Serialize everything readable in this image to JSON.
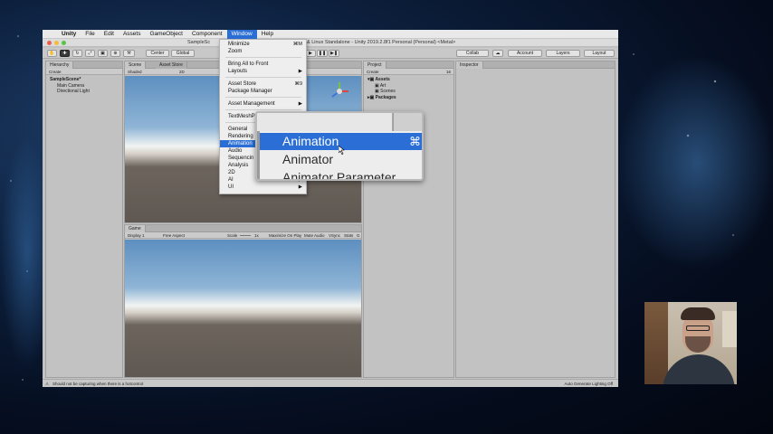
{
  "menubar": {
    "app": "Unity",
    "items": [
      "File",
      "Edit",
      "Assets",
      "GameObject",
      "Component",
      "Window",
      "Help"
    ]
  },
  "window": {
    "title_left": "SampleSc",
    "title_right": "& Linux Standalone - Unity 2019.2.8f1 Personal (Personal) <Metal>"
  },
  "toolbar": {
    "center": "Center",
    "global": "Global",
    "collab": "Collab",
    "account": "Account",
    "layers": "Layers",
    "layout": "Layout"
  },
  "hierarchy": {
    "tab": "Hierarchy",
    "create": "Create",
    "scene": "SampleScene*",
    "items": [
      "Main Camera",
      "Directional Light"
    ]
  },
  "scene": {
    "tab": "Scene",
    "asset_store_tab": "Asset Store",
    "shaded": "Shaded",
    "mode2d": "2D"
  },
  "game": {
    "tab": "Game",
    "display": "Display 1",
    "aspect": "Free Aspect",
    "scale_label": "Scale",
    "scale_value": "1x",
    "maximize": "Maximize On Play",
    "mute": "Mute Audio",
    "vsync": "VSync",
    "stats": "Stats",
    "gizmos": "G"
  },
  "project": {
    "tab": "Project",
    "create": "Create",
    "assets": "Assets",
    "art": "Art",
    "scenes": "Scenes",
    "packages": "Packages",
    "count": "16"
  },
  "inspector": {
    "tab": "Inspector"
  },
  "status": {
    "message": "Should not be capturing when there is a hotcontrol",
    "right": "Auto Generate Lighting Off"
  },
  "window_menu": {
    "minimize": "Minimize",
    "minimize_sc": "⌘M",
    "zoom": "Zoom",
    "bring_all": "Bring All to Front",
    "layouts": "Layouts",
    "asset_store": "Asset Store",
    "asset_store_sc": "⌘9",
    "package_manager": "Package Manager",
    "asset_management": "Asset Management",
    "textmesh": "TextMeshP",
    "general": "General",
    "rendering": "Rendering",
    "animation": "Animation",
    "audio": "Audio",
    "sequencing": "Sequencin",
    "analysis": "Analysis",
    "mode2d": "2D",
    "ai": "AI",
    "ui": "UI",
    "arrow": "▶"
  },
  "submenu": {
    "items": [
      "Animation",
      "Animator",
      "Animator Parameter"
    ],
    "animation_sc": "⌘"
  }
}
